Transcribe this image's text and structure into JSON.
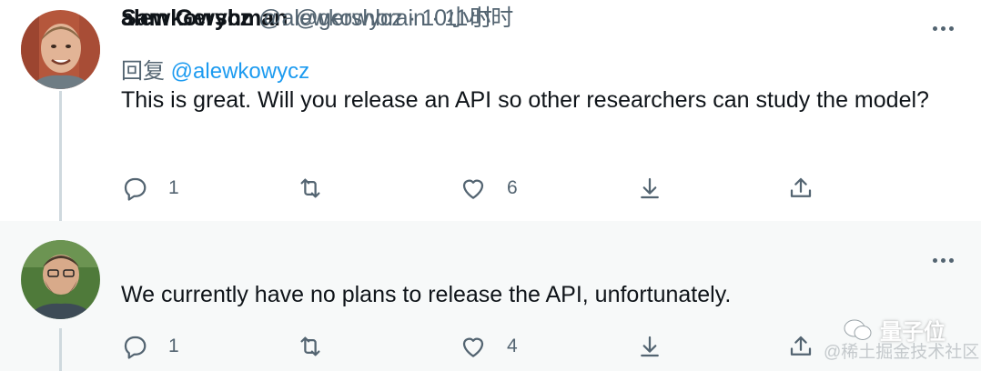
{
  "tweets": [
    {
      "name": "Sam Gershman",
      "handle": "@gershbrain",
      "separator": "·",
      "time": "11小时",
      "reply_prefix": "回复",
      "reply_to": "@alewkowycz",
      "text": "This is great. Will you release an API so other researchers can study the model?",
      "reply_count": "1",
      "retweet_count": "",
      "like_count": "6"
    },
    {
      "name": "alewkowycz",
      "handle": "@alewkowycz",
      "separator": "·",
      "time": "10小时",
      "text": "We currently have no plans to release the API, unfortunately.",
      "reply_count": "1",
      "retweet_count": "",
      "like_count": "4"
    }
  ],
  "watermark": {
    "badge": "量子位",
    "source": "@稀土掘金技术社区"
  },
  "colors": {
    "link": "#1d9bf0",
    "secondary_text": "#536471",
    "thread_line": "#cfd9de",
    "highlight_bg": "#f7f9f9"
  }
}
